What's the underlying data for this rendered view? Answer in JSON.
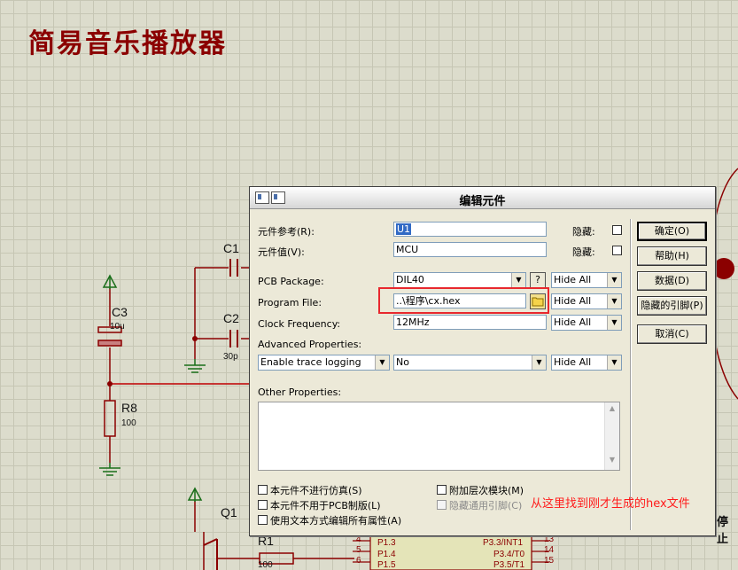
{
  "canvas": {
    "title": "简易音乐播放器",
    "components": {
      "c1": "C1",
      "c2": "C2",
      "c2_value": "30p",
      "c3": "C3",
      "c3_value": "10u",
      "r8": "R8",
      "r8_value": "100",
      "q1": "Q1",
      "r1": "R1",
      "r1_value": "100",
      "stop_label": "停止"
    },
    "pins": [
      {
        "num": "4",
        "name": "P1.3"
      },
      {
        "num": "5",
        "name": "P1.4"
      },
      {
        "num": "6",
        "name": "P1.5"
      }
    ],
    "pins_right": [
      {
        "num": "13",
        "name": "P3.3/INT1"
      },
      {
        "num": "14",
        "name": "P3.4/T0"
      },
      {
        "num": "15",
        "name": "P3.5/T1"
      }
    ]
  },
  "dialog": {
    "title": "编辑元件",
    "fields": {
      "part_reference": {
        "label": "元件参考(R):",
        "value": "U1",
        "hidden_label": "隐藏:"
      },
      "part_value": {
        "label": "元件值(V):",
        "value": "MCU",
        "hidden_label": "隐藏:"
      },
      "pcb_package": {
        "label": "PCB Package:",
        "value": "DIL40",
        "visibility": "Hide All",
        "help_button": "?"
      },
      "program_file": {
        "label": "Program File:",
        "value": "..\\程序\\cx.hex",
        "visibility": "Hide All"
      },
      "clock_frequency": {
        "label": "Clock Frequency:",
        "value": "12MHz",
        "visibility": "Hide All"
      },
      "advanced": {
        "label": "Advanced Properties:",
        "property": "Enable trace logging",
        "value": "No",
        "visibility": "Hide All"
      },
      "other": {
        "label": "Other Properties:"
      }
    },
    "checkboxes": {
      "exclude_sim": "本元件不进行仿真(S)",
      "exclude_pcb": "本元件不用于PCB制版(L)",
      "edit_text": "使用文本方式编辑所有属性(A)",
      "attach_hier": "附加层次模块(M)",
      "hide_pins": "隐藏通用引脚(C)"
    },
    "buttons": {
      "ok": "确定(O)",
      "help": "帮助(H)",
      "data": "数据(D)",
      "hidden_pins": "隐藏的引脚(P)",
      "cancel": "取消(C)"
    }
  },
  "annotation": {
    "text": "从这里找到刚才生成的hex文件",
    "color": "#ff1a1a"
  }
}
